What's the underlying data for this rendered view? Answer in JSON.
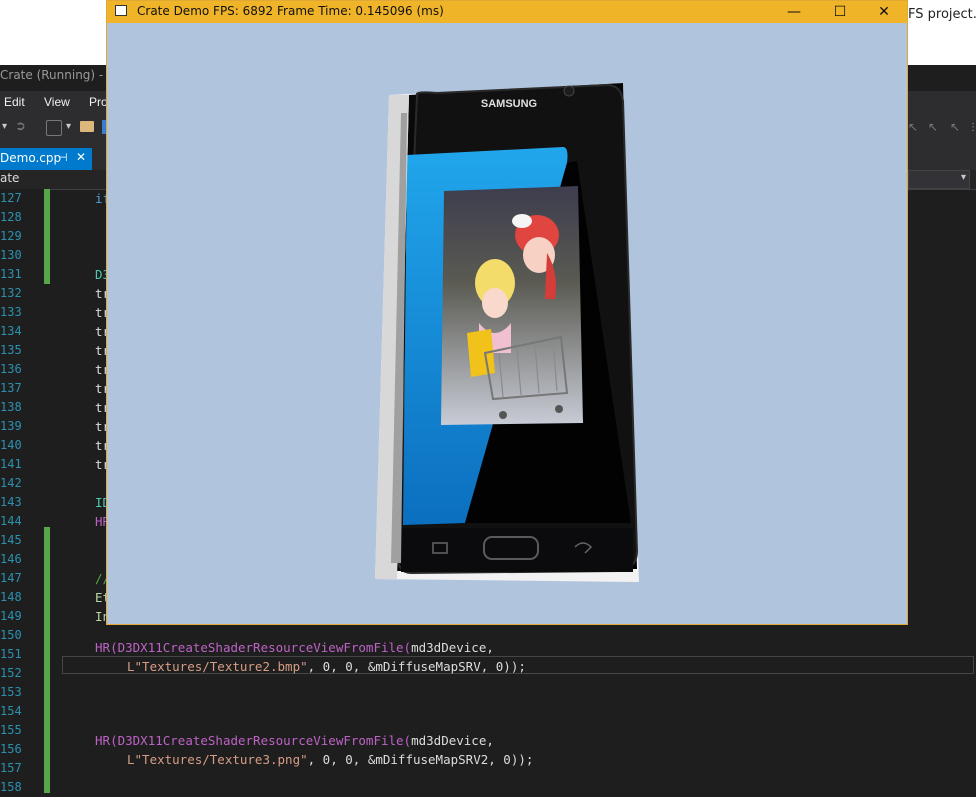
{
  "vs": {
    "top_text": "FS project.",
    "title": "Crate (Running) - M",
    "menu": [
      "Edit",
      "View",
      "Pro"
    ],
    "tab_label": "Demo.cpp",
    "nav_label": "ate",
    "line_numbers": [
      "127",
      "128",
      "129",
      "130",
      "131",
      "132",
      "133",
      "134",
      "135",
      "136",
      "137",
      "138",
      "139",
      "140",
      "141",
      "142",
      "143",
      "144",
      "145",
      "146",
      "147",
      "148",
      "149",
      "150",
      "151",
      "152",
      "153",
      "154",
      "155",
      "156",
      "157",
      "158"
    ],
    "code_fragments": {
      "l127": "if",
      "l131": "D3",
      "l132": "tr",
      "l133": "tr",
      "l134": "tr",
      "l135": "tr",
      "l136": "tr",
      "l137": "tr",
      "l138": "tr",
      "l139": "tr",
      "l140": "tr",
      "l141": "tr",
      "l143": "ID",
      "l144": "HR",
      "l147": "//",
      "l148": "Et",
      "l149": "In"
    },
    "code_lines": {
      "l151_macro": "HR",
      "l151_fn": "(D3DX11CreateShaderResourceViewFromFile(",
      "l151_arg": "md3dDevice,",
      "l152_str": "L\"Textures/Texture2.bmp\"",
      "l152_rest": ", 0, 0, &mDiffuseMapSRV, 0));",
      "l156_macro": "HR",
      "l156_fn": "(D3DX11CreateShaderResourceViewFromFile(",
      "l156_arg": "md3dDevice,",
      "l157_str": "L\"Textures/Texture3.png\"",
      "l157_rest": ", 0, 0, &mDiffuseMapSRV2, 0));"
    }
  },
  "demo": {
    "title": "Crate Demo    FPS: 6892    Frame Time: 0.145096 (ms)",
    "minimize_glyph": "—",
    "maximize_glyph": "☐",
    "close_glyph": "✕",
    "phone_brand": "SAMSUNG",
    "client_color": "#b0c4de",
    "titlebar_color": "#f0b429"
  }
}
